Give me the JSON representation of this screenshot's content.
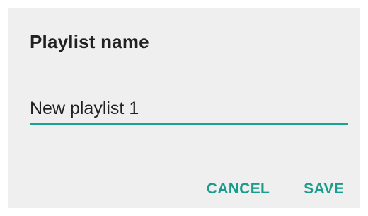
{
  "dialog": {
    "title": "Playlist name",
    "input": {
      "value": "New playlist 1",
      "placeholder": ""
    },
    "actions": {
      "cancel_label": "CANCEL",
      "save_label": "SAVE"
    }
  },
  "colors": {
    "accent": "#19a392",
    "dialog_background": "#efefef",
    "text": "#212121"
  }
}
